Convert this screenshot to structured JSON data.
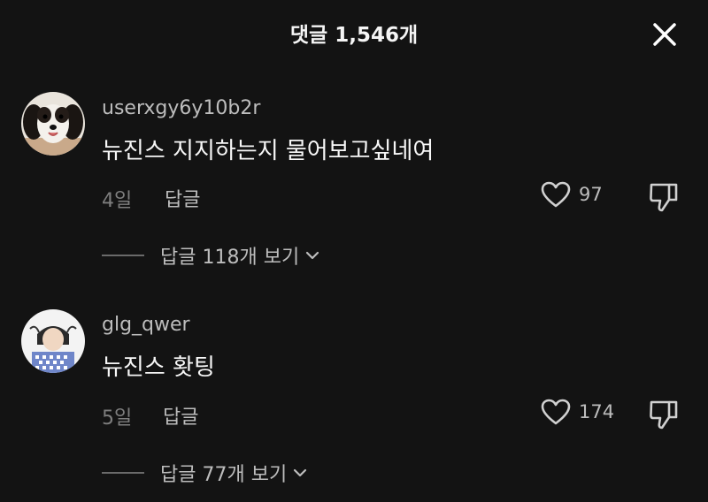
{
  "header": {
    "title": "댓글 1,546개"
  },
  "comments": [
    {
      "username": "userxgy6y10b2r",
      "text": "뉴진스 지지하는지 물어보고싶네여",
      "age": "4일",
      "reply_label": "답글",
      "likes": "97",
      "view_replies": "답글 118개 보기"
    },
    {
      "username": "glg_qwer",
      "text": "뉴진스 홧팅",
      "age": "5일",
      "reply_label": "답글",
      "likes": "174",
      "view_replies": "답글 77개 보기"
    }
  ],
  "icons": {
    "close": "close-icon",
    "like": "heart-icon",
    "dislike": "thumbs-down-icon",
    "expand": "chevron-down-icon"
  },
  "colors": {
    "background": "#131313",
    "primary_text": "#f7f7f7",
    "secondary_text": "#bdbdbd",
    "muted_text": "#7e7e7e"
  }
}
